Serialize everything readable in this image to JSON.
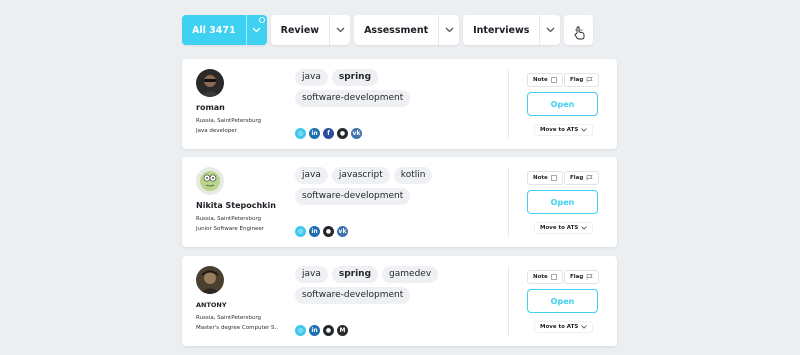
{
  "filters": [
    {
      "label": "All 3471",
      "active": true
    },
    {
      "label": "Review",
      "active": false
    },
    {
      "label": "Assessment",
      "active": false
    },
    {
      "label": "Interviews",
      "active": false
    }
  ],
  "actions": {
    "note": "Note",
    "flag": "Flag",
    "open": "Open",
    "move_to_ats": "Move to ATS"
  },
  "candidates": [
    {
      "name": "roman",
      "location": "Russia, SaintPetersburg",
      "title": "Java developer",
      "tags": [
        {
          "t": "java"
        },
        {
          "t": "spring"
        },
        {
          "t": "software-development"
        }
      ],
      "socials": [
        "website-icon",
        "linkedin-icon",
        "facebook-icon",
        "github-icon",
        "vk-icon"
      ]
    },
    {
      "name": "Nikita Stepochkin",
      "location": "Russia, SaintPetersburg",
      "title": "Junior Software Engineer",
      "tags": [
        {
          "t": "java"
        },
        {
          "t": "javascript"
        },
        {
          "t": "kotlin"
        },
        {
          "t": "software-development"
        }
      ],
      "socials": [
        "website-icon",
        "linkedin-icon",
        "github-icon",
        "vk-icon"
      ]
    },
    {
      "name": "ANTONY",
      "location": "Russia, SaintPetersburg",
      "title": "Master's degree Computer S...",
      "tags": [
        {
          "t": "java"
        },
        {
          "t": "spring"
        },
        {
          "t": "gamedev"
        },
        {
          "t": "software-development"
        }
      ],
      "socials": [
        "website-icon",
        "linkedin-icon",
        "github-icon",
        "medium-icon"
      ]
    }
  ],
  "colors": {
    "accent": "#3fd1f1",
    "background": "#eceff2"
  }
}
